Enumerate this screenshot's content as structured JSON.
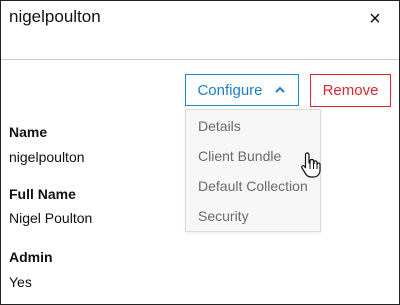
{
  "header": {
    "title": "nigelpoulton",
    "close_icon": "×"
  },
  "actions": {
    "configure_label": "Configure",
    "remove_label": "Remove",
    "configure_color": "#1d8ad6",
    "remove_color": "#d9272e"
  },
  "dropdown": {
    "items": [
      {
        "label": "Details"
      },
      {
        "label": "Client Bundle"
      },
      {
        "label": "Default Collection"
      },
      {
        "label": "Security"
      }
    ]
  },
  "fields": [
    {
      "label": "Name",
      "value": "nigelpoulton"
    },
    {
      "label": "Full Name",
      "value": "Nigel Poulton"
    },
    {
      "label": "Admin",
      "value": "Yes"
    }
  ]
}
